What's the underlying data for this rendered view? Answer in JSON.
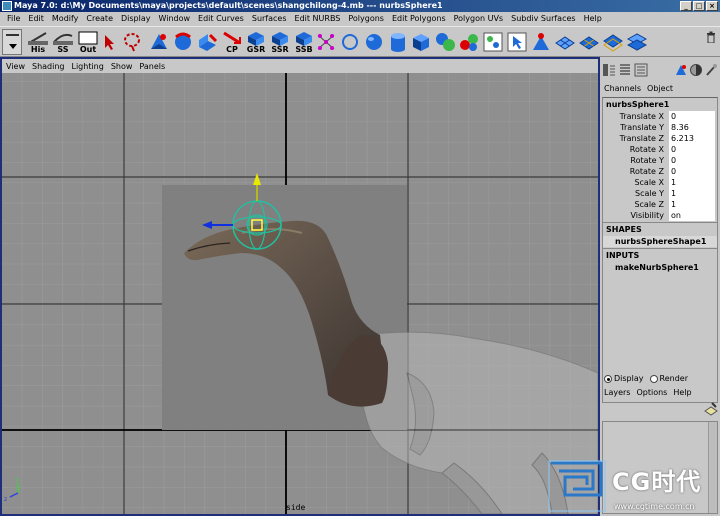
{
  "window": {
    "title": "Maya 7.0: d:\\My Documents\\maya\\projects\\default\\scenes\\shangchilong-4.mb   ---   nurbsSphere1",
    "controls": [
      "_",
      "□",
      "×"
    ]
  },
  "menubar": [
    "File",
    "Edit",
    "Modify",
    "Create",
    "Display",
    "Window",
    "Edit Curves",
    "Surfaces",
    "Edit NURBS",
    "Polygons",
    "Edit Polygons",
    "Polygon UVs",
    "Subdiv Surfaces",
    "Help"
  ],
  "shelf": {
    "buttons": [
      {
        "name": "his",
        "label": "His"
      },
      {
        "name": "ss",
        "label": "SS"
      },
      {
        "name": "out",
        "label": "Out"
      },
      {
        "name": "cp",
        "label": "CP"
      },
      {
        "name": "gsr",
        "label": "GSR"
      },
      {
        "name": "ssr",
        "label": "SSR"
      },
      {
        "name": "ssb",
        "label": "SSB"
      }
    ]
  },
  "panel_menu": [
    "View",
    "Shading",
    "Lighting",
    "Show",
    "Panels"
  ],
  "viewport": {
    "camera_label": "side"
  },
  "channel_box": {
    "menu": [
      "Channels",
      "Object"
    ],
    "object_name": "nurbsSphere1",
    "channels": [
      {
        "label": "Translate X",
        "value": "0"
      },
      {
        "label": "Translate Y",
        "value": "8.36"
      },
      {
        "label": "Translate Z",
        "value": "6.213"
      },
      {
        "label": "Rotate X",
        "value": "0"
      },
      {
        "label": "Rotate Y",
        "value": "0"
      },
      {
        "label": "Rotate Z",
        "value": "0"
      },
      {
        "label": "Scale X",
        "value": "1"
      },
      {
        "label": "Scale Y",
        "value": "1"
      },
      {
        "label": "Scale Z",
        "value": "1"
      },
      {
        "label": "Visibility",
        "value": "on"
      }
    ],
    "shapes_header": "SHAPES",
    "shape_node": "nurbsSphereShape1",
    "inputs_header": "INPUTS",
    "input_node": "makeNurbSphere1"
  },
  "layer_editor": {
    "radio_display": "Display",
    "radio_render": "Render",
    "selected": "Display",
    "menu": [
      "Layers",
      "Options",
      "Help"
    ]
  },
  "watermark": {
    "text": "CG时代",
    "url": "www.cgtime.com.cn"
  }
}
